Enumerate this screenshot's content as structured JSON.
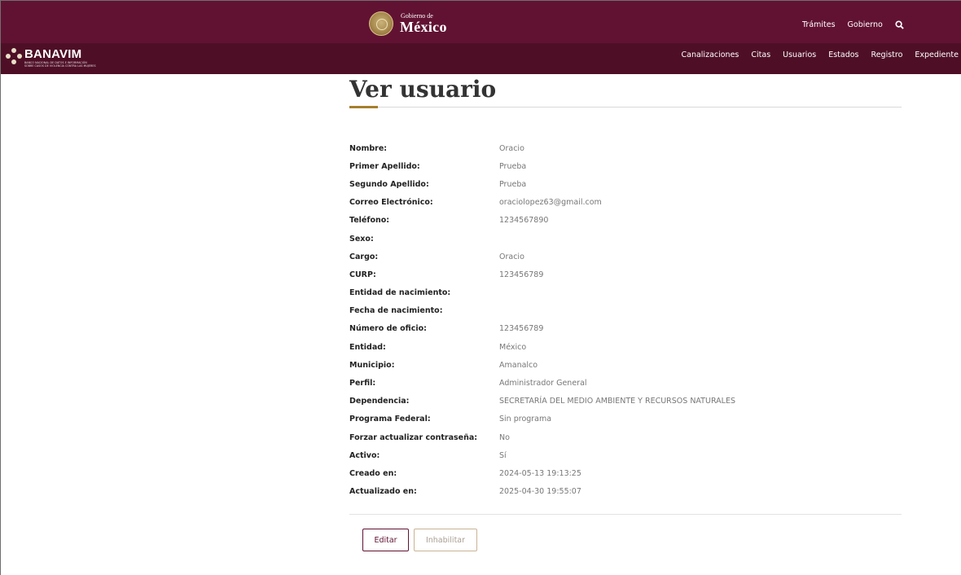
{
  "header": {
    "gov_small": "Gobierno de",
    "gov_big": "México",
    "links": [
      "Trámites",
      "Gobierno"
    ],
    "search_icon": "search-icon"
  },
  "appbar": {
    "brand": "BANAVIM",
    "brand_sub_1": "BANCO NACIONAL DE DATOS E INFORMACIÓN",
    "brand_sub_2": "SOBRE CASOS DE VIOLENCIA CONTRA LAS MUJERES",
    "nav": [
      "Canalizaciones",
      "Citas",
      "Usuarios",
      "Estados",
      "Registro",
      "Expediente"
    ]
  },
  "page": {
    "title": "Ver usuario"
  },
  "details": [
    {
      "label": "Nombre:",
      "value": "Oracio"
    },
    {
      "label": "Primer Apellido:",
      "value": "Prueba"
    },
    {
      "label": "Segundo Apellido:",
      "value": "Prueba"
    },
    {
      "label": "Correo Electrónico:",
      "value": "oraciolopez63@gmail.com"
    },
    {
      "label": "Teléfono:",
      "value": "1234567890"
    },
    {
      "label": "Sexo:",
      "value": ""
    },
    {
      "label": "Cargo:",
      "value": "Oracio"
    },
    {
      "label": "CURP:",
      "value": "123456789"
    },
    {
      "label": "Entidad de nacimiento:",
      "value": ""
    },
    {
      "label": "Fecha de nacimiento:",
      "value": ""
    },
    {
      "label": "Número de oficio:",
      "value": "123456789"
    },
    {
      "label": "Entidad:",
      "value": "México"
    },
    {
      "label": "Municipio:",
      "value": "Amanalco"
    },
    {
      "label": "Perfil:",
      "value": "Administrador General"
    },
    {
      "label": "Dependencia:",
      "value": "SECRETARÍA DEL MEDIO AMBIENTE Y RECURSOS NATURALES"
    },
    {
      "label": "Programa Federal:",
      "value": "Sin programa"
    },
    {
      "label": "Forzar actualizar contraseña:",
      "value": "No"
    },
    {
      "label": "Activo:",
      "value": "Sí"
    },
    {
      "label": "Creado en:",
      "value": "2024-05-13 19:13:25"
    },
    {
      "label": "Actualizado en:",
      "value": "2025-04-30 19:55:07"
    }
  ],
  "actions": {
    "edit": "Editar",
    "disable": "Inhabilitar"
  },
  "colors": {
    "gov_bar": "#611232",
    "app_bar": "#4e0f26",
    "accent_gold": "#a57f2c"
  }
}
